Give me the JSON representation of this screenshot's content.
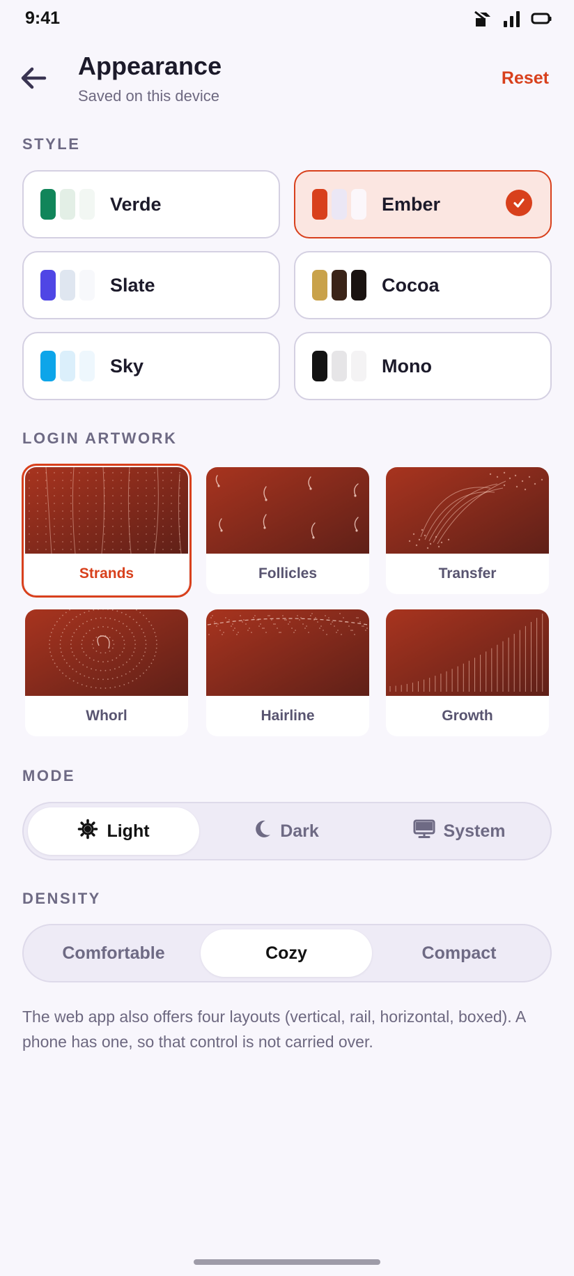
{
  "status_bar": {
    "time": "9:41",
    "icons": [
      "notification-icon",
      "signal-icon",
      "battery-icon"
    ]
  },
  "header": {
    "title": "Appearance",
    "subtitle": "Saved on this device",
    "reset_label": "Reset",
    "back_icon": "arrow-left-icon"
  },
  "accent_color": "#d8401c",
  "style_section": {
    "label": "STYLE",
    "options": [
      {
        "name": "Verde",
        "swatches": [
          "#11855a",
          "#e3efe6",
          "#f2f7f3"
        ],
        "selected": false
      },
      {
        "name": "Ember",
        "swatches": [
          "#d8401c",
          "#ebe7f5",
          "#fbf7fb"
        ],
        "selected": true
      },
      {
        "name": "Slate",
        "swatches": [
          "#4f46e5",
          "#dfe6f0",
          "#f7f8fb"
        ],
        "selected": false
      },
      {
        "name": "Cocoa",
        "swatches": [
          "#c9a24a",
          "#3b2418",
          "#1a1311"
        ],
        "selected": false
      },
      {
        "name": "Sky",
        "swatches": [
          "#0ea5e9",
          "#dbeffb",
          "#eef7fd"
        ],
        "selected": false
      },
      {
        "name": "Mono",
        "swatches": [
          "#121212",
          "#e6e5e7",
          "#f4f3f4"
        ],
        "selected": false
      }
    ]
  },
  "artwork_section": {
    "label": "LOGIN ARTWORK",
    "options": [
      {
        "name": "Strands",
        "selected": true
      },
      {
        "name": "Follicles",
        "selected": false
      },
      {
        "name": "Transfer",
        "selected": false
      },
      {
        "name": "Whorl",
        "selected": false
      },
      {
        "name": "Hairline",
        "selected": false
      },
      {
        "name": "Growth",
        "selected": false
      }
    ]
  },
  "mode_section": {
    "label": "MODE",
    "options": [
      {
        "name": "Light",
        "icon": "sun-icon",
        "active": true
      },
      {
        "name": "Dark",
        "icon": "moon-icon",
        "active": false
      },
      {
        "name": "System",
        "icon": "monitor-icon",
        "active": false
      }
    ]
  },
  "density_section": {
    "label": "DENSITY",
    "options": [
      {
        "name": "Comfortable",
        "active": false
      },
      {
        "name": "Cozy",
        "active": true
      },
      {
        "name": "Compact",
        "active": false
      }
    ]
  },
  "note": "The web app also offers four layouts (vertical, rail, horizontal, boxed). A phone has one, so that control is not carried over."
}
